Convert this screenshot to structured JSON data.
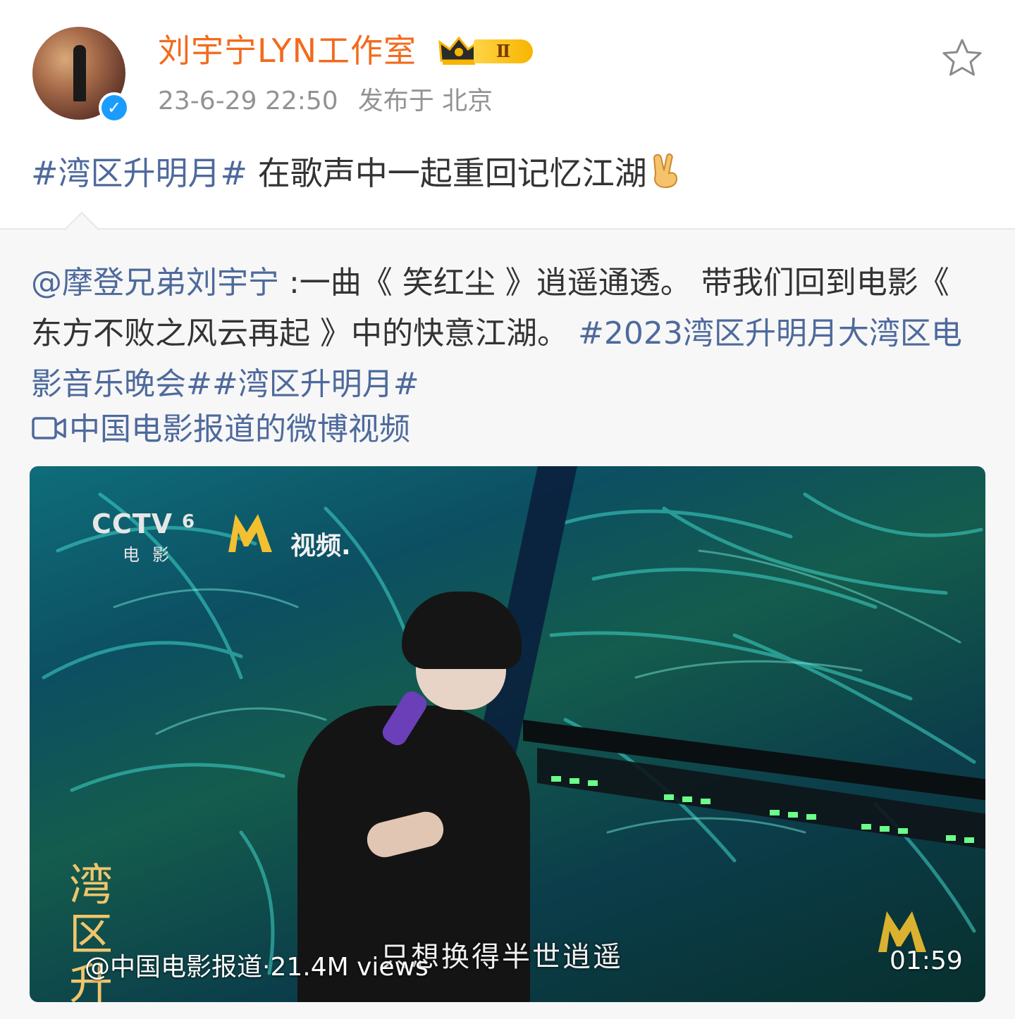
{
  "author": {
    "name": "刘宇宁LYN工作室",
    "badge_level": "Ⅱ",
    "timestamp": "23-6-29 22:50",
    "location": "发布于 北京"
  },
  "post": {
    "hashtag": "#湾区升明月#",
    "text": " 在歌声中一起重回记忆江湖",
    "emoji": "victory-hand"
  },
  "repost": {
    "mention": "@摩登兄弟刘宇宁",
    "text": " :一曲《 笑红尘 》逍遥通透。 带我们回到电影《 东方不败之风云再起 》中的快意江湖。 ",
    "hashtag1": "#2023湾区升明月大湾区电影音乐晚会#",
    "hashtag2": "#湾区升明月#",
    "video_link": "中国电影报道的微博视频"
  },
  "video": {
    "channel_logo": "CCTV",
    "channel_number": "6",
    "channel_sub": "电影",
    "m_logo_text": "视频.",
    "corner_logo": "湾区升明",
    "subtitle": "只想换得半世逍遥",
    "stats": "@中国电影报道·21.4M views",
    "duration": "01:59"
  },
  "colors": {
    "username": "#f26b1d",
    "link": "#4e6a9c",
    "meta": "#939393",
    "verified": "#1a9cff"
  }
}
